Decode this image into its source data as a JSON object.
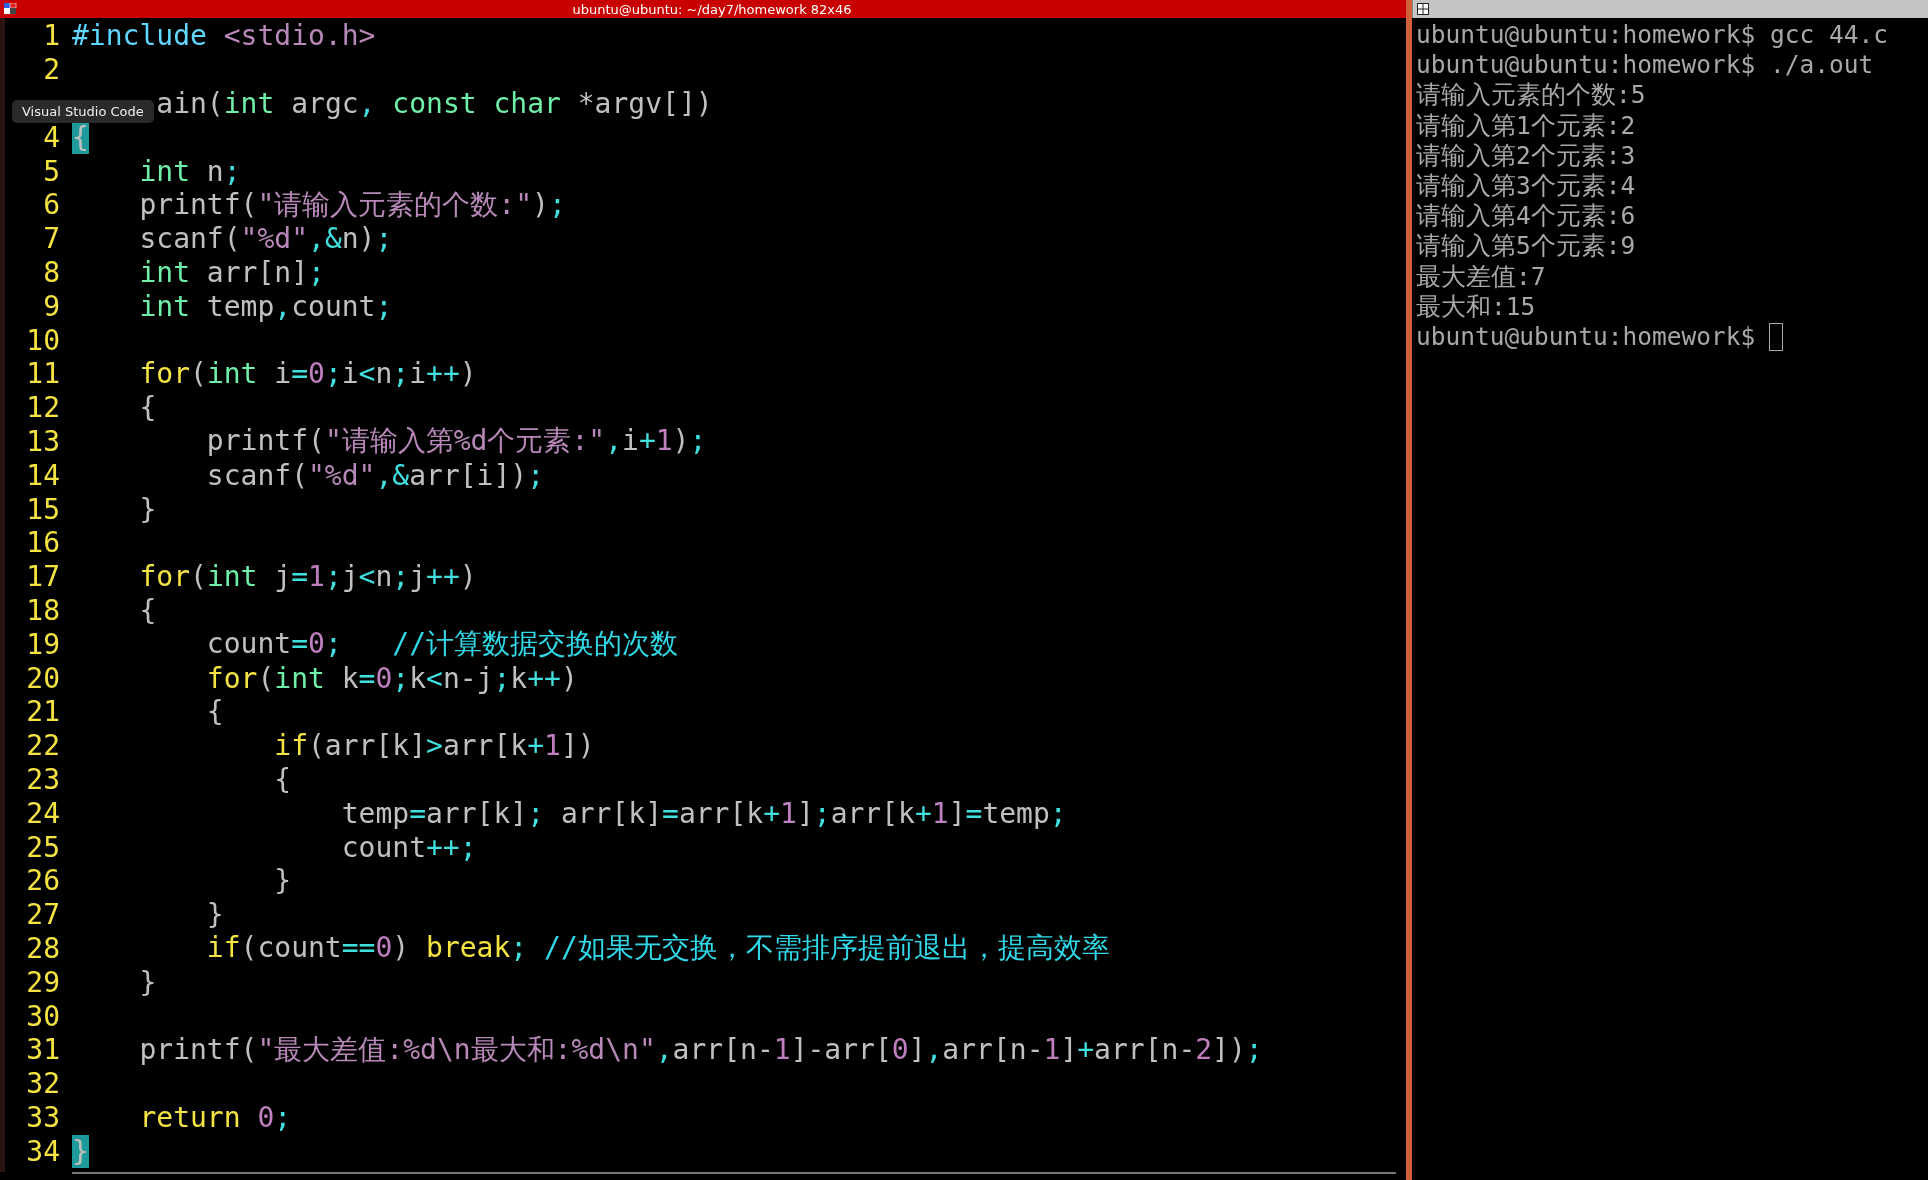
{
  "window": {
    "title": "ubuntu@ubuntu: ~/day7/homework 82x46"
  },
  "tooltip": "Visual Studio Code",
  "editor": {
    "lines": [
      {
        "number": "1",
        "tokens": [
          {
            "kind": "preproc",
            "text": "#include"
          },
          {
            "kind": "string",
            "text": " <stdio.h>"
          }
        ]
      },
      {
        "number": "2"
      },
      {
        "tokens": [
          {
            "kind": "plain",
            "text": "     ain("
          },
          {
            "kind": "type",
            "text": "int"
          },
          {
            "kind": "plain",
            "text": " argc"
          },
          {
            "kind": "op",
            "text": ","
          },
          {
            "kind": "type",
            "text": " const char"
          },
          {
            "kind": "plain",
            "text": " *argv[])"
          }
        ]
      },
      {
        "number": "4",
        "tokens": [
          {
            "kind": "match",
            "text": "{"
          }
        ]
      },
      {
        "number": "5",
        "tokens": [
          {
            "kind": "type",
            "text": "    int"
          },
          {
            "kind": "plain",
            "text": " n"
          },
          {
            "kind": "op",
            "text": ";"
          }
        ]
      },
      {
        "number": "6",
        "tokens": [
          {
            "kind": "plain",
            "text": "    printf("
          },
          {
            "kind": "string",
            "text": "\"请输入元素的个数:\""
          },
          {
            "kind": "plain",
            "text": ")"
          },
          {
            "kind": "op",
            "text": ";"
          }
        ]
      },
      {
        "number": "7",
        "tokens": [
          {
            "kind": "plain",
            "text": "    scanf("
          },
          {
            "kind": "string",
            "text": "\"%d\""
          },
          {
            "kind": "op",
            "text": ",&"
          },
          {
            "kind": "plain",
            "text": "n)"
          },
          {
            "kind": "op",
            "text": ";"
          }
        ]
      },
      {
        "number": "8",
        "tokens": [
          {
            "kind": "type",
            "text": "    int"
          },
          {
            "kind": "plain",
            "text": " arr[n]"
          },
          {
            "kind": "op",
            "text": ";"
          }
        ]
      },
      {
        "number": "9",
        "tokens": [
          {
            "kind": "type",
            "text": "    int"
          },
          {
            "kind": "plain",
            "text": " temp"
          },
          {
            "kind": "op",
            "text": ","
          },
          {
            "kind": "plain",
            "text": "count"
          },
          {
            "kind": "op",
            "text": ";"
          }
        ]
      },
      {
        "number": "10"
      },
      {
        "number": "11",
        "tokens": [
          {
            "kind": "keyword",
            "text": "    for"
          },
          {
            "kind": "plain",
            "text": "("
          },
          {
            "kind": "type",
            "text": "int"
          },
          {
            "kind": "plain",
            "text": " i"
          },
          {
            "kind": "op",
            "text": "="
          },
          {
            "kind": "number",
            "text": "0"
          },
          {
            "kind": "op",
            "text": ";"
          },
          {
            "kind": "plain",
            "text": "i"
          },
          {
            "kind": "op",
            "text": "<"
          },
          {
            "kind": "plain",
            "text": "n"
          },
          {
            "kind": "op",
            "text": ";"
          },
          {
            "kind": "plain",
            "text": "i"
          },
          {
            "kind": "op",
            "text": "++"
          },
          {
            "kind": "plain",
            "text": ")"
          }
        ]
      },
      {
        "number": "12",
        "tokens": [
          {
            "kind": "plain",
            "text": "    {"
          }
        ]
      },
      {
        "number": "13",
        "tokens": [
          {
            "kind": "plain",
            "text": "        printf("
          },
          {
            "kind": "string",
            "text": "\"请输入第%d个元素:\""
          },
          {
            "kind": "op",
            "text": ","
          },
          {
            "kind": "plain",
            "text": "i"
          },
          {
            "kind": "op",
            "text": "+"
          },
          {
            "kind": "number",
            "text": "1"
          },
          {
            "kind": "plain",
            "text": ")"
          },
          {
            "kind": "op",
            "text": ";"
          }
        ]
      },
      {
        "number": "14",
        "tokens": [
          {
            "kind": "plain",
            "text": "        scanf("
          },
          {
            "kind": "string",
            "text": "\"%d\""
          },
          {
            "kind": "op",
            "text": ",&"
          },
          {
            "kind": "plain",
            "text": "arr[i])"
          },
          {
            "kind": "op",
            "text": ";"
          }
        ]
      },
      {
        "number": "15",
        "tokens": [
          {
            "kind": "plain",
            "text": "    }"
          }
        ]
      },
      {
        "number": "16"
      },
      {
        "number": "17",
        "tokens": [
          {
            "kind": "keyword",
            "text": "    for"
          },
          {
            "kind": "plain",
            "text": "("
          },
          {
            "kind": "type",
            "text": "int"
          },
          {
            "kind": "plain",
            "text": " j"
          },
          {
            "kind": "op",
            "text": "="
          },
          {
            "kind": "number",
            "text": "1"
          },
          {
            "kind": "op",
            "text": ";"
          },
          {
            "kind": "plain",
            "text": "j"
          },
          {
            "kind": "op",
            "text": "<"
          },
          {
            "kind": "plain",
            "text": "n"
          },
          {
            "kind": "op",
            "text": ";"
          },
          {
            "kind": "plain",
            "text": "j"
          },
          {
            "kind": "op",
            "text": "++"
          },
          {
            "kind": "plain",
            "text": ")"
          }
        ]
      },
      {
        "number": "18",
        "tokens": [
          {
            "kind": "plain",
            "text": "    {"
          }
        ]
      },
      {
        "number": "19",
        "tokens": [
          {
            "kind": "plain",
            "text": "        count"
          },
          {
            "kind": "op",
            "text": "="
          },
          {
            "kind": "number",
            "text": "0"
          },
          {
            "kind": "op",
            "text": ";"
          },
          {
            "kind": "comment",
            "text": "   //计算数据交换的次数"
          }
        ]
      },
      {
        "number": "20",
        "tokens": [
          {
            "kind": "keyword",
            "text": "        for"
          },
          {
            "kind": "plain",
            "text": "("
          },
          {
            "kind": "type",
            "text": "int"
          },
          {
            "kind": "plain",
            "text": " k"
          },
          {
            "kind": "op",
            "text": "="
          },
          {
            "kind": "number",
            "text": "0"
          },
          {
            "kind": "op",
            "text": ";"
          },
          {
            "kind": "plain",
            "text": "k"
          },
          {
            "kind": "op",
            "text": "<"
          },
          {
            "kind": "plain",
            "text": "n-j"
          },
          {
            "kind": "op",
            "text": ";"
          },
          {
            "kind": "plain",
            "text": "k"
          },
          {
            "kind": "op",
            "text": "++"
          },
          {
            "kind": "plain",
            "text": ")"
          }
        ]
      },
      {
        "number": "21",
        "tokens": [
          {
            "kind": "plain",
            "text": "        {"
          }
        ]
      },
      {
        "number": "22",
        "tokens": [
          {
            "kind": "keyword",
            "text": "            if"
          },
          {
            "kind": "plain",
            "text": "(arr[k]"
          },
          {
            "kind": "op",
            "text": ">"
          },
          {
            "kind": "plain",
            "text": "arr[k"
          },
          {
            "kind": "op",
            "text": "+"
          },
          {
            "kind": "number",
            "text": "1"
          },
          {
            "kind": "plain",
            "text": "])"
          }
        ]
      },
      {
        "number": "23",
        "tokens": [
          {
            "kind": "plain",
            "text": "            {"
          }
        ]
      },
      {
        "number": "24",
        "tokens": [
          {
            "kind": "plain",
            "text": "                temp"
          },
          {
            "kind": "op",
            "text": "="
          },
          {
            "kind": "plain",
            "text": "arr[k]"
          },
          {
            "kind": "op",
            "text": ";"
          },
          {
            "kind": "plain",
            "text": " arr[k]"
          },
          {
            "kind": "op",
            "text": "="
          },
          {
            "kind": "plain",
            "text": "arr[k"
          },
          {
            "kind": "op",
            "text": "+"
          },
          {
            "kind": "number",
            "text": "1"
          },
          {
            "kind": "plain",
            "text": "]"
          },
          {
            "kind": "op",
            "text": ";"
          },
          {
            "kind": "plain",
            "text": "arr[k"
          },
          {
            "kind": "op",
            "text": "+"
          },
          {
            "kind": "number",
            "text": "1"
          },
          {
            "kind": "plain",
            "text": "]"
          },
          {
            "kind": "op",
            "text": "="
          },
          {
            "kind": "plain",
            "text": "temp"
          },
          {
            "kind": "op",
            "text": ";"
          }
        ]
      },
      {
        "number": "25",
        "tokens": [
          {
            "kind": "plain",
            "text": "                count"
          },
          {
            "kind": "op",
            "text": "++;"
          }
        ]
      },
      {
        "number": "26",
        "tokens": [
          {
            "kind": "plain",
            "text": "            }"
          }
        ]
      },
      {
        "number": "27",
        "tokens": [
          {
            "kind": "plain",
            "text": "        }"
          }
        ]
      },
      {
        "number": "28",
        "tokens": [
          {
            "kind": "keyword",
            "text": "        if"
          },
          {
            "kind": "plain",
            "text": "(count"
          },
          {
            "kind": "op",
            "text": "=="
          },
          {
            "kind": "number",
            "text": "0"
          },
          {
            "kind": "plain",
            "text": ") "
          },
          {
            "kind": "keyword",
            "text": "break"
          },
          {
            "kind": "op",
            "text": ";"
          },
          {
            "kind": "comment",
            "text": " //如果无交换，不需排序提前退出，提高效率"
          }
        ]
      },
      {
        "number": "29",
        "tokens": [
          {
            "kind": "plain",
            "text": "    }"
          }
        ]
      },
      {
        "number": "30"
      },
      {
        "number": "31",
        "tokens": [
          {
            "kind": "plain",
            "text": "    printf("
          },
          {
            "kind": "string",
            "text": "\"最大差值:%d\\n最大和:%d\\n\""
          },
          {
            "kind": "op",
            "text": ","
          },
          {
            "kind": "plain",
            "text": "arr[n-"
          },
          {
            "kind": "number",
            "text": "1"
          },
          {
            "kind": "plain",
            "text": "]-arr["
          },
          {
            "kind": "number",
            "text": "0"
          },
          {
            "kind": "plain",
            "text": "]"
          },
          {
            "kind": "op",
            "text": ","
          },
          {
            "kind": "plain",
            "text": "arr[n-"
          },
          {
            "kind": "number",
            "text": "1"
          },
          {
            "kind": "plain",
            "text": "]"
          },
          {
            "kind": "op",
            "text": "+"
          },
          {
            "kind": "plain",
            "text": "arr[n-"
          },
          {
            "kind": "number",
            "text": "2"
          },
          {
            "kind": "plain",
            "text": "])"
          },
          {
            "kind": "op",
            "text": ";"
          }
        ]
      },
      {
        "number": "32"
      },
      {
        "number": "33",
        "tokens": [
          {
            "kind": "keyword",
            "text": "    return"
          },
          {
            "kind": "number",
            "text": " 0"
          },
          {
            "kind": "op",
            "text": ";"
          }
        ]
      },
      {
        "number": "34",
        "tokens": [
          {
            "kind": "match",
            "text": "}"
          }
        ]
      }
    ]
  },
  "terminal": {
    "lines": [
      "ubuntu@ubuntu:homework$ gcc 44.c",
      "ubuntu@ubuntu:homework$ ./a.out",
      "请输入元素的个数:5",
      "请输入第1个元素:2",
      "请输入第2个元素:3",
      "请输入第3个元素:4",
      "请输入第4个元素:6",
      "请输入第5个元素:9",
      "最大差值:7",
      "最大和:15"
    ],
    "prompt": "ubuntu@ubuntu:homework$"
  }
}
